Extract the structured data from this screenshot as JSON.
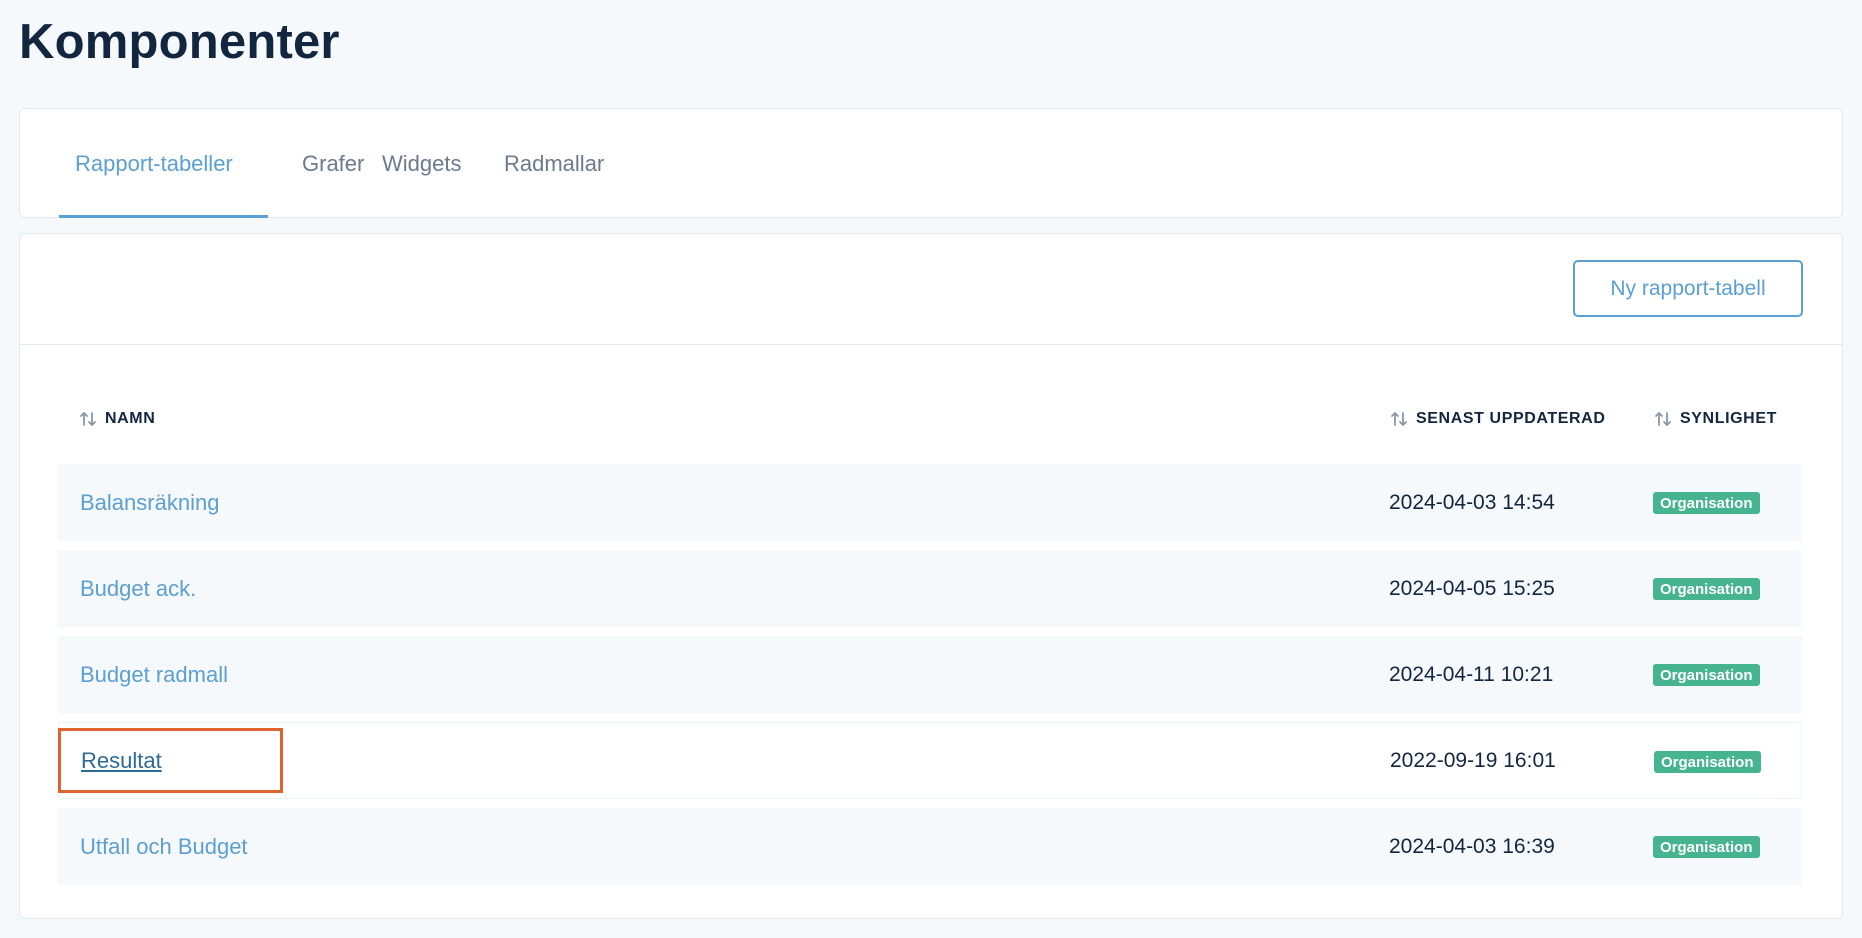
{
  "page": {
    "title": "Komponenter"
  },
  "tabs": [
    {
      "label": "Rapport-tabeller",
      "active": true
    },
    {
      "label": "Grafer",
      "active": false
    },
    {
      "label": "Widgets",
      "active": false
    },
    {
      "label": "Radmallar",
      "active": false
    }
  ],
  "toolbar": {
    "new_button_label": "Ny rapport-tabell"
  },
  "table": {
    "columns": {
      "name": "NAMN",
      "updated": "SENAST UPPDATERAD",
      "visibility": "SYNLIGHET"
    },
    "sort_icon": "sort-up-down-icon",
    "rows": [
      {
        "name": "Balansräkning",
        "updated": "2024-04-03 14:54",
        "visibility": "Organisation"
      },
      {
        "name": "Budget ack.",
        "updated": "2024-04-05 15:25",
        "visibility": "Organisation"
      },
      {
        "name": "Budget radmall",
        "updated": "2024-04-11 10:21",
        "visibility": "Organisation"
      },
      {
        "name": "Resultat",
        "updated": "2022-09-19 16:01",
        "visibility": "Organisation"
      },
      {
        "name": "Utfall och Budget",
        "updated": "2024-04-03 16:39",
        "visibility": "Organisation"
      }
    ]
  },
  "colors": {
    "accent": "#5b9fd3",
    "badge": "#45b48f",
    "highlight": "#e0622e",
    "text": "#12263f"
  }
}
